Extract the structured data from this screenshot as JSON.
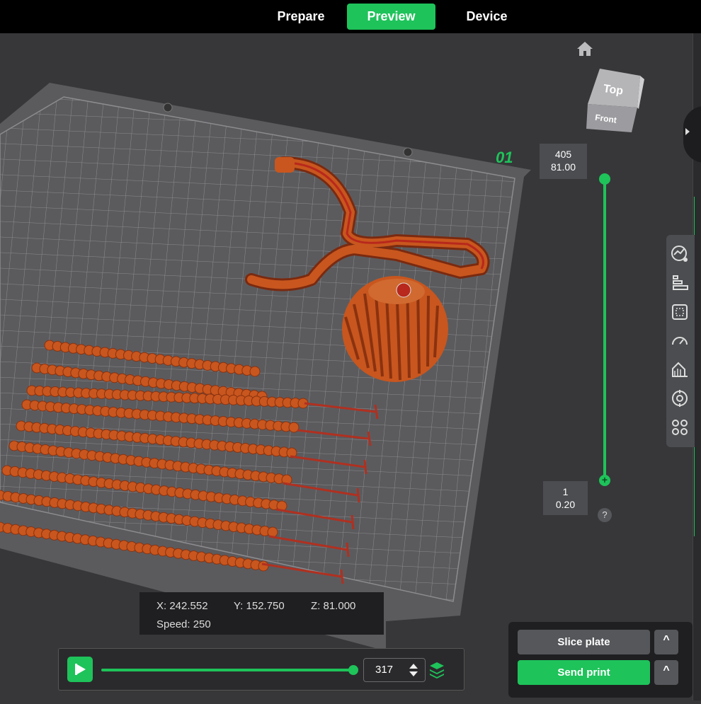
{
  "tabs": [
    {
      "label": "Prepare"
    },
    {
      "label": "Preview",
      "active": true
    },
    {
      "label": "Device"
    }
  ],
  "plate": {
    "label": "01"
  },
  "nav_cube": {
    "top_label": "Top",
    "front_label": "Front"
  },
  "layer_slider": {
    "top": {
      "layer": "405",
      "height": "81.00"
    },
    "bottom": {
      "layer": "1",
      "height": "0.20"
    },
    "help": "?"
  },
  "coords": {
    "x": "X: 242.552",
    "y": "Y: 152.750",
    "z": "Z: 81.000",
    "speed": "Speed: 250"
  },
  "playback": {
    "step": "317",
    "progress": 1.0
  },
  "actions": {
    "slice_label": "Slice plate",
    "send_label": "Send print",
    "caret": "^"
  },
  "colors": {
    "accent": "#1ec35a",
    "filament": "#c8561e",
    "bed": "#5a5a5c"
  },
  "tools": [
    "statistics-icon",
    "layer-align-icon",
    "bounding-box-icon",
    "speed-icon",
    "support-painting-icon",
    "seam-icon",
    "assembly-icon"
  ]
}
